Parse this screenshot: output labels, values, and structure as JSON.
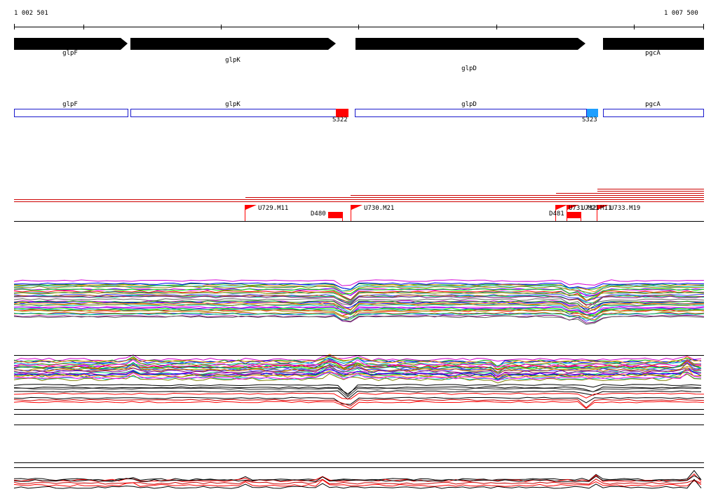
{
  "ruler": {
    "start_label": "1 002 501",
    "end_label": "1 007 500"
  },
  "genes": [
    {
      "name": "glpF",
      "strand": "+"
    },
    {
      "name": "glpK",
      "strand": "+"
    },
    {
      "name": "glpD",
      "strand": "+"
    },
    {
      "name": "pgcA",
      "strand": "+"
    }
  ],
  "annotation_features": [
    "S322",
    "S323"
  ],
  "transcript_features": [
    "U729.M11",
    "D480",
    "U730.M21",
    "D481",
    "U731.M21",
    "U732.M11",
    "U733.M19"
  ],
  "colors": {
    "gene_arrow": "#000000",
    "gene_box_border": "#1a1acc",
    "feature_red": "#ff0000",
    "feature_blue": "#1e9fff",
    "axis": "#000000"
  }
}
